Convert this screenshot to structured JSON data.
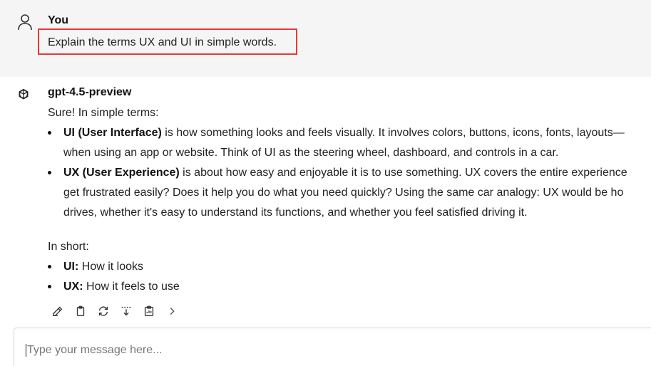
{
  "user": {
    "name": "You",
    "message": "Explain the terms UX and UI in simple words."
  },
  "assistant": {
    "name": "gpt-4.5-preview",
    "intro": "Sure! In simple terms:",
    "bullets": [
      {
        "term": "UI (User Interface)",
        "line1": " is how something looks and feels visually. It involves colors, buttons, icons, fonts, layouts—",
        "line2": "when using an app or website. Think of UI as the steering wheel, dashboard, and controls in a car."
      },
      {
        "term": "UX (User Experience)",
        "line1": " is about how easy and enjoyable it is to use something. UX covers the entire experience",
        "line2": "get frustrated easily? Does it help you do what you need quickly? Using the same car analogy: UX would be ho",
        "line3": "drives, whether it's easy to understand its functions, and whether you feel satisfied driving it."
      }
    ],
    "summary_label": "In short:",
    "summary": [
      {
        "term": "UI:",
        "text": " How it looks"
      },
      {
        "term": "UX:",
        "text": " How it feels to use"
      }
    ]
  },
  "actions": [
    "edit-icon",
    "copy-icon",
    "regenerate-icon",
    "insert-icon",
    "clipboard-icon",
    "chevron-right-icon"
  ],
  "input": {
    "placeholder": "Type your message here..."
  },
  "colors": {
    "highlight_border": "#e23b3b",
    "user_bg": "#f5f5f5"
  }
}
